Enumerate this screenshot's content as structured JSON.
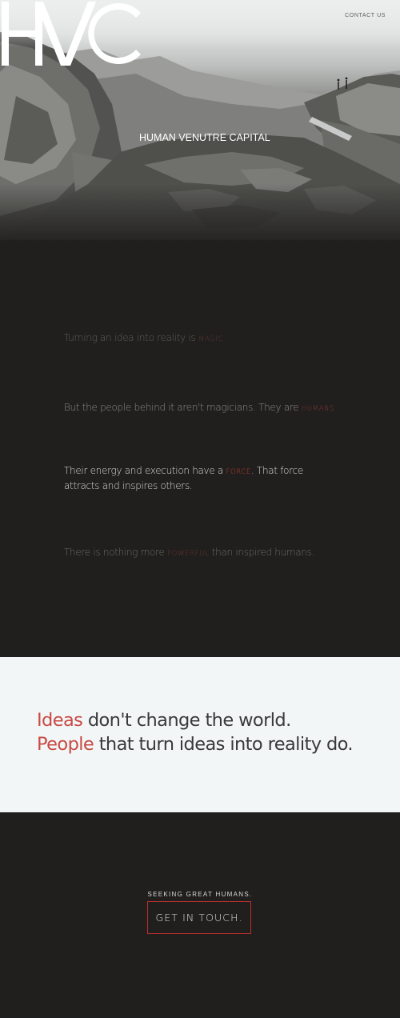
{
  "header": {
    "contact_link": "CONTACT US"
  },
  "hero": {
    "logo_letters": "HVC",
    "logo_text": "HUMAN VENUTRE CAPITAL"
  },
  "manifesto": [
    {
      "before": "Turning an idea into reality is ",
      "accent": "MAGIC",
      "after": ""
    },
    {
      "before": "But the people behind it aren't magicians. They are ",
      "accent": "HUMANS",
      "after": ""
    },
    {
      "before": "Their energy and execution have a ",
      "accent": "FORCE",
      "after": ".  That force attracts and inspires others."
    },
    {
      "before": "There is nothing more ",
      "accent": "POWERFUL",
      "after": " than inspired humans."
    }
  ],
  "quote": {
    "line1_highlight": "Ideas",
    "line1_rest": " don't change the world.",
    "line2_highlight": "People",
    "line2_rest": " that turn ideas into reality do."
  },
  "cta": {
    "label": "SEEKING GREAT HUMANS.",
    "button": "GET IN TOUCH."
  },
  "colors": {
    "accent": "#c94a45",
    "dark_bg": "#201f1d",
    "light_bg": "#f2f6f7"
  }
}
